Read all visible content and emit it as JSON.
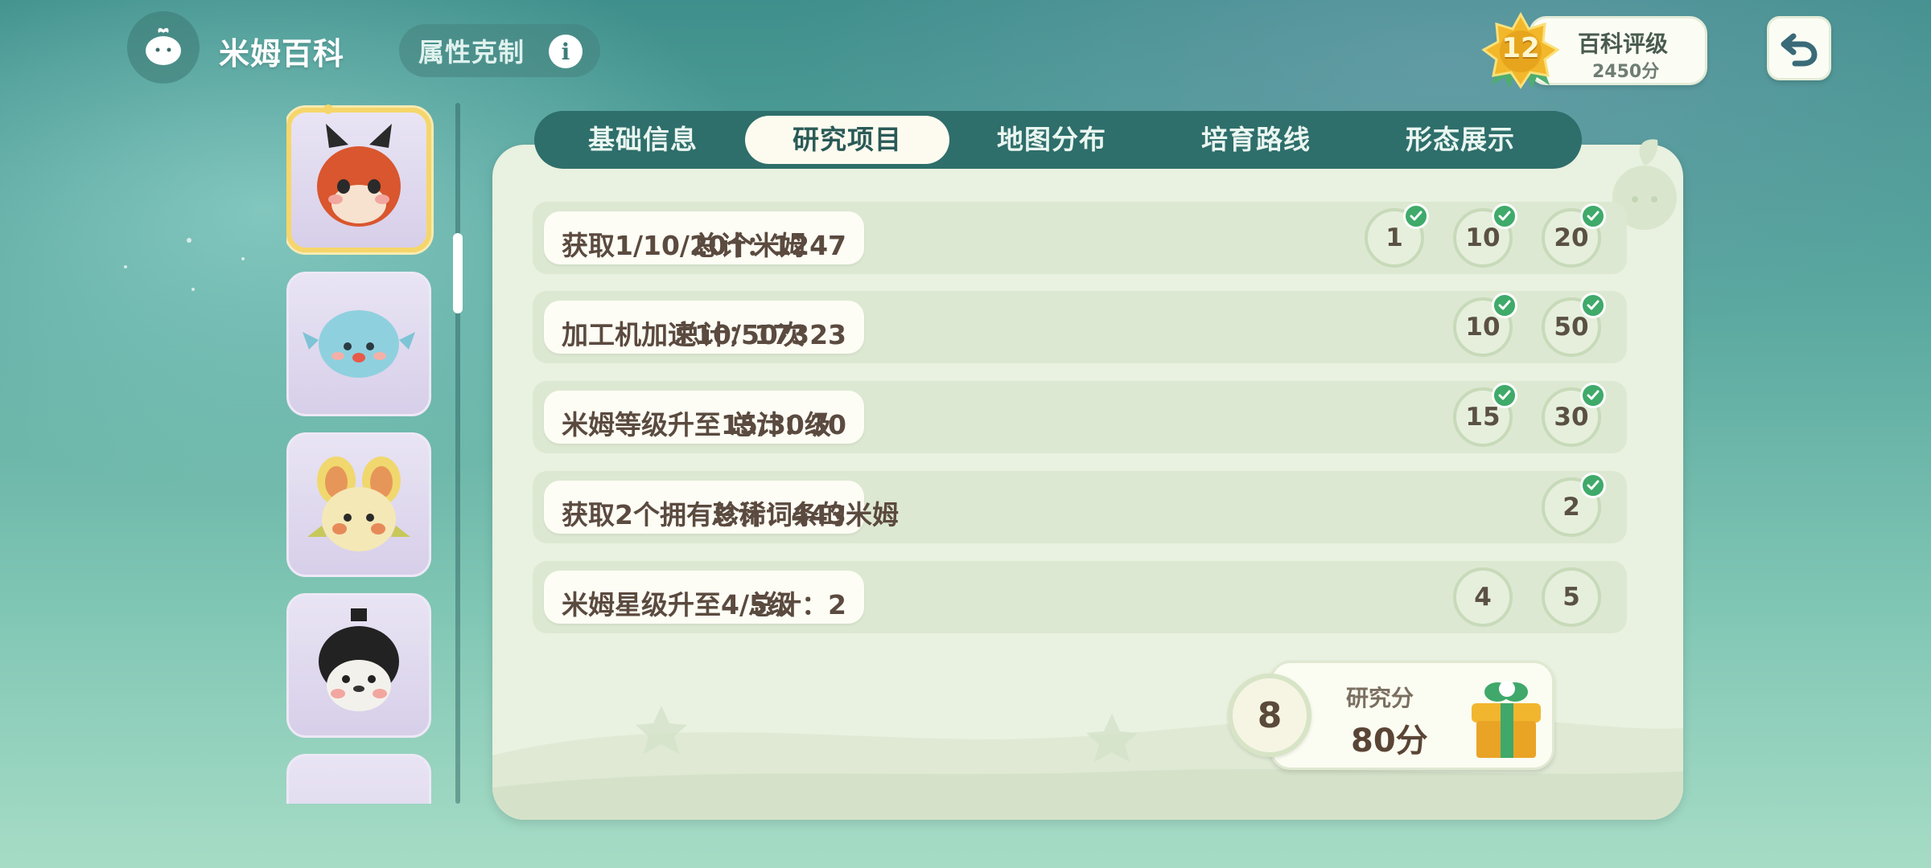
{
  "header": {
    "app_title": "米姆百科",
    "attr_button_label": "属性克制",
    "info_glyph": "i"
  },
  "rating": {
    "level": "12",
    "title": "百科评级",
    "score": "2450分"
  },
  "tabs": [
    {
      "label": "基础信息",
      "active": false
    },
    {
      "label": "研究项目",
      "active": true
    },
    {
      "label": "地图分布",
      "active": false
    },
    {
      "label": "培育路线",
      "active": false
    },
    {
      "label": "形态展示",
      "active": false
    }
  ],
  "tasks": [
    {
      "name": "获取1/10/20个米姆",
      "total": "总计：1247",
      "milestones": [
        {
          "value": "1",
          "done": true
        },
        {
          "value": "10",
          "done": true
        },
        {
          "value": "20",
          "done": true
        }
      ]
    },
    {
      "name": "加工机加速10/50次",
      "total": "总计：17323",
      "milestones": [
        {
          "value": "10",
          "done": true
        },
        {
          "value": "50",
          "done": true
        }
      ]
    },
    {
      "name": "米姆等级升至15/30级",
      "total": "总计：30",
      "milestones": [
        {
          "value": "15",
          "done": true
        },
        {
          "value": "30",
          "done": true
        }
      ]
    },
    {
      "name": "获取2个拥有珍稀词条的米姆",
      "total": "总计：443",
      "milestones": [
        {
          "value": "2",
          "done": true
        }
      ]
    },
    {
      "name": "米姆星级升至4/5级",
      "total": "总计：2",
      "milestones": [
        {
          "value": "4",
          "done": false
        },
        {
          "value": "5",
          "done": false
        }
      ]
    }
  ],
  "research": {
    "count": "8",
    "label": "研究分",
    "value": "80分"
  },
  "creatures": [
    {
      "name": "orange-fox-creature-icon",
      "selected": true
    },
    {
      "name": "blue-pufferfish-creature-icon",
      "selected": false
    },
    {
      "name": "yellow-mouse-creature-icon",
      "selected": false
    },
    {
      "name": "black-white-panda-creature-icon",
      "selected": false
    },
    {
      "name": "antlered-creature-icon",
      "selected": false
    }
  ],
  "colors": {
    "tab_bar": "#2e6e6b",
    "panel": "#e9f1e0",
    "check": "#3faa6a",
    "selected_border": "#f6d66a"
  }
}
